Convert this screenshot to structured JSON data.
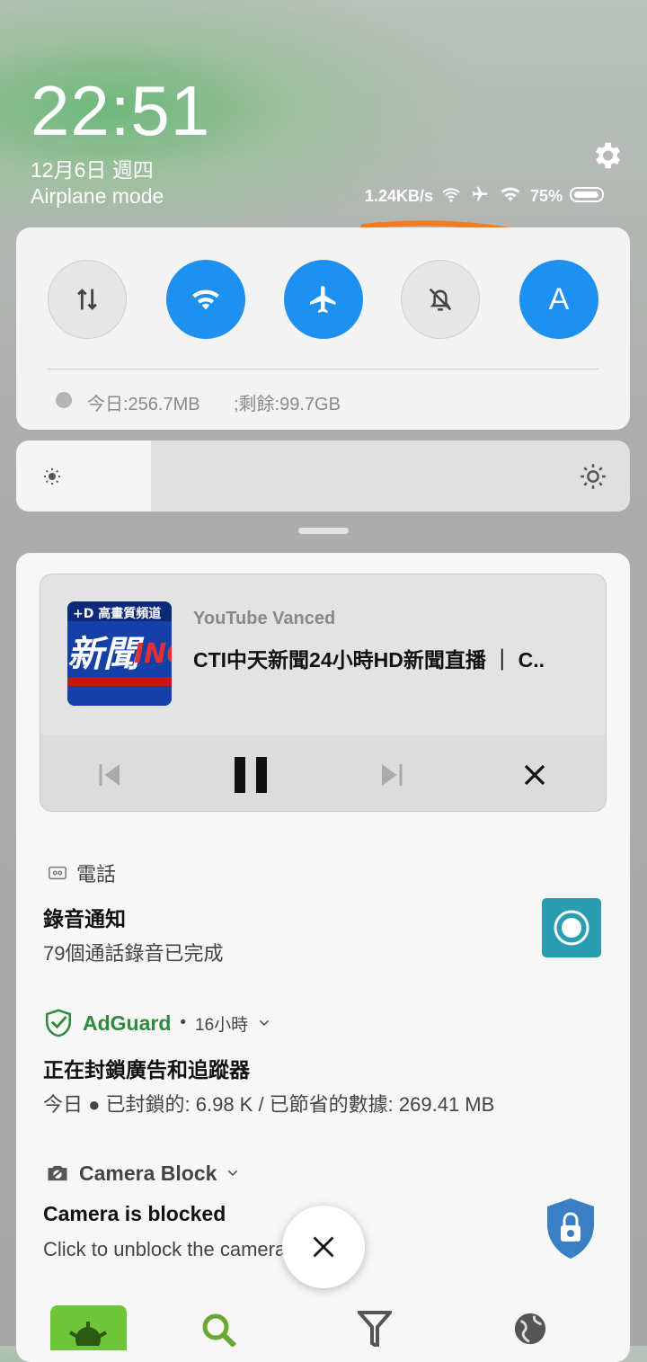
{
  "header": {
    "time": "22:51",
    "date": "12月6日 週四",
    "mode_label": "Airplane mode",
    "net_speed": "1.24KB/s",
    "battery": "75%"
  },
  "quick_settings": {
    "tiles": [
      {
        "name": "mobile-data",
        "state": "off"
      },
      {
        "name": "wifi",
        "state": "on"
      },
      {
        "name": "airplane-mode",
        "state": "on"
      },
      {
        "name": "silent",
        "state": "off"
      },
      {
        "name": "auto-brightness",
        "label": "A",
        "state": "on"
      }
    ],
    "data_today": "今日:256.7MB",
    "data_remaining": ";剩餘:99.7GB",
    "accent": "#1e90f0"
  },
  "brightness": {
    "level": 0.22
  },
  "media": {
    "app": "YouTube Vanced",
    "title": "CTI中天新聞24小時HD新聞直播 ｜ C..",
    "controls": [
      "previous",
      "pause",
      "next",
      "close"
    ]
  },
  "notifications": [
    {
      "app": "電話",
      "title": "錄音通知",
      "body": "79個通話錄音已完成"
    },
    {
      "app": "AdGuard",
      "time": "16小時",
      "title": "正在封鎖廣告和追蹤器",
      "body": "今日 ● 已封鎖的: 6.98 K / 已節省的數據: 269.41 MB",
      "app_color": "#2e8b3d"
    },
    {
      "app": "Camera Block",
      "title": "Camera is blocked",
      "body": "Click to unblock the camera"
    }
  ]
}
